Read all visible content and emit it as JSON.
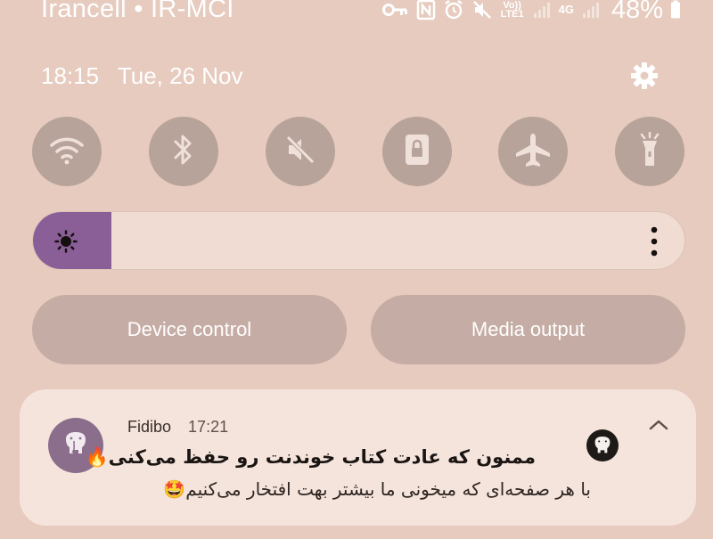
{
  "status_bar": {
    "carrier": "Irancell • IR-MCI",
    "net1_label": "Vo)) LTE1",
    "net2_label": "4G",
    "battery_percent": "48%",
    "icons": [
      "key-icon",
      "nfc-icon",
      "alarm-icon",
      "mute-icon",
      "volte-icon",
      "signal-icon",
      "signal-icon-2",
      "battery-icon"
    ]
  },
  "header": {
    "time": "18:15",
    "date": "Tue, 26 Nov"
  },
  "quick_settings": {
    "tiles": [
      {
        "name": "wifi",
        "icon": "wifi-icon",
        "active": false
      },
      {
        "name": "bluetooth",
        "icon": "bluetooth-icon",
        "active": false
      },
      {
        "name": "sound",
        "icon": "mute-icon",
        "active": false
      },
      {
        "name": "rotation-lock",
        "icon": "lock-icon",
        "active": false
      },
      {
        "name": "airplane-mode",
        "icon": "airplane-icon",
        "active": false
      },
      {
        "name": "flashlight",
        "icon": "flashlight-icon",
        "active": false
      }
    ],
    "brightness_level": 0.12
  },
  "buttons": {
    "device_control": "Device control",
    "media_output": "Media output"
  },
  "notification": {
    "app_name": "Fidibo",
    "time": "17:21",
    "title": "ممنون که عادت کتاب خوندنت رو حفظ می‌کنی🔥",
    "body": "با هر صفحه‌ای که میخونی ما بیشتر بهت افتخار می‌کنیم🤩"
  },
  "colors": {
    "background": "#e6cbbe",
    "tile": "#b8a39b",
    "brightness_accent": "#8a5f97",
    "notification_bg": "#f5e4dc"
  }
}
